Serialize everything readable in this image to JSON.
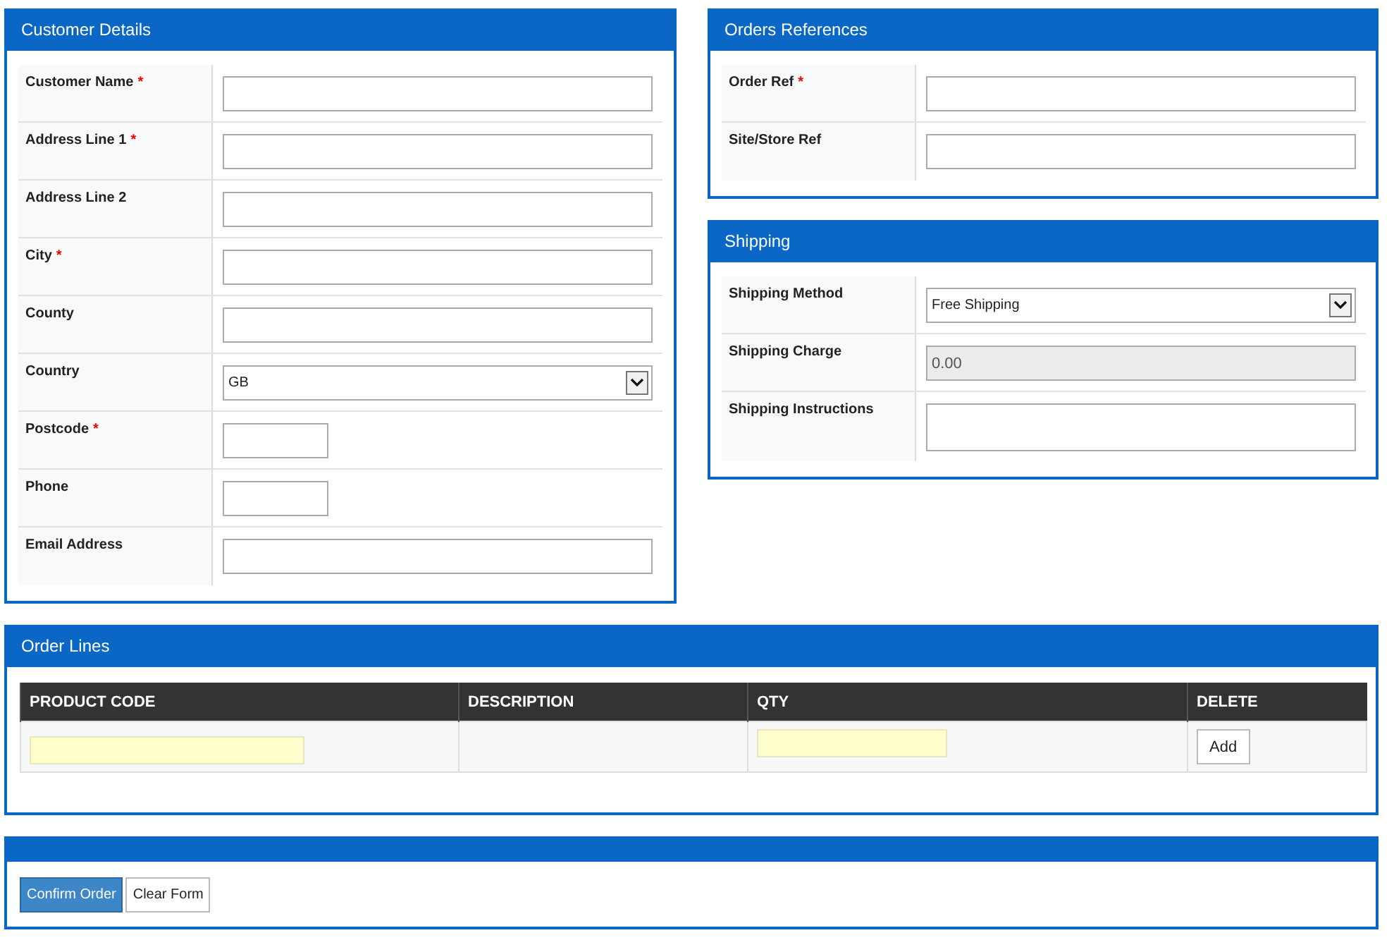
{
  "customer_details": {
    "title": "Customer Details",
    "fields": [
      {
        "label": "Customer Name",
        "required_mark": "*",
        "kind": "text"
      },
      {
        "label": "Address Line 1",
        "required_mark": "*",
        "kind": "text"
      },
      {
        "label": "Address Line 2",
        "kind": "text"
      },
      {
        "label": "City",
        "required_mark": "*",
        "kind": "text"
      },
      {
        "label": "County",
        "kind": "text"
      },
      {
        "label": "Country",
        "kind": "select",
        "value": "GB"
      },
      {
        "label": "Postcode",
        "required_mark": "*",
        "kind": "short"
      },
      {
        "label": "Phone",
        "kind": "short"
      },
      {
        "label": "Email Address",
        "kind": "text"
      }
    ]
  },
  "orders_references": {
    "title": "Orders References",
    "fields": [
      {
        "label": "Order Ref",
        "required_mark": "*",
        "kind": "text"
      },
      {
        "label": "Site/Store Ref",
        "kind": "text"
      }
    ]
  },
  "shipping": {
    "title": "Shipping",
    "fields": [
      {
        "label": "Shipping Method",
        "kind": "select",
        "value": "Free Shipping"
      },
      {
        "label": "Shipping Charge",
        "kind": "text",
        "value": "0.00",
        "disabled": true
      },
      {
        "label": "Shipping Instructions",
        "kind": "textarea"
      }
    ]
  },
  "order_lines": {
    "title": "Order Lines",
    "columns": [
      "PRODUCT CODE",
      "DESCRIPTION",
      "QTY",
      "DELETE"
    ],
    "row": {
      "action_button": "Add"
    }
  },
  "actions": {
    "buttons": [
      {
        "label": "Confirm Order",
        "primary": true
      },
      {
        "label": "Clear Form",
        "primary": false
      }
    ]
  }
}
